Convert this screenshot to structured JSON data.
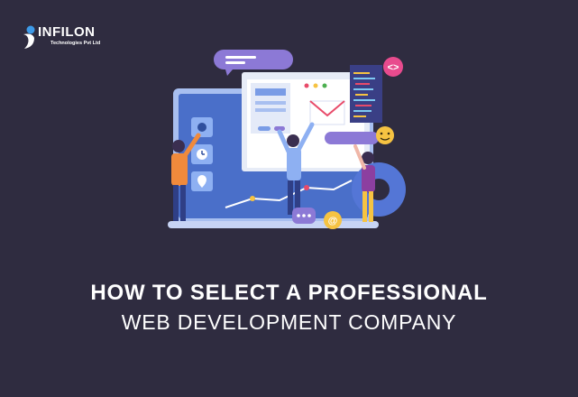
{
  "brand": {
    "name": "INFILON",
    "tagline": "Technologies Pvt Ltd"
  },
  "headline": {
    "line1": "HOW TO SELECT A PROFESSIONAL",
    "line2": "WEB DEVELOPMENT COMPANY"
  },
  "illustration": {
    "code_badge": "<>",
    "mention_badge": "@",
    "icons": [
      "logo-mark-icon",
      "laptop-icon",
      "browser-window-icon",
      "mail-envelope-icon",
      "code-editor-icon",
      "gear-icon",
      "smiley-icon",
      "chat-bubble-icon",
      "clock-icon",
      "camera-icon",
      "location-pin-icon"
    ]
  },
  "colors": {
    "background": "#2f2c40",
    "laptop_screen": "#4a6fc9",
    "accent_purple": "#8c79d6",
    "accent_yellow": "#f6c342",
    "text": "#ffffff"
  }
}
